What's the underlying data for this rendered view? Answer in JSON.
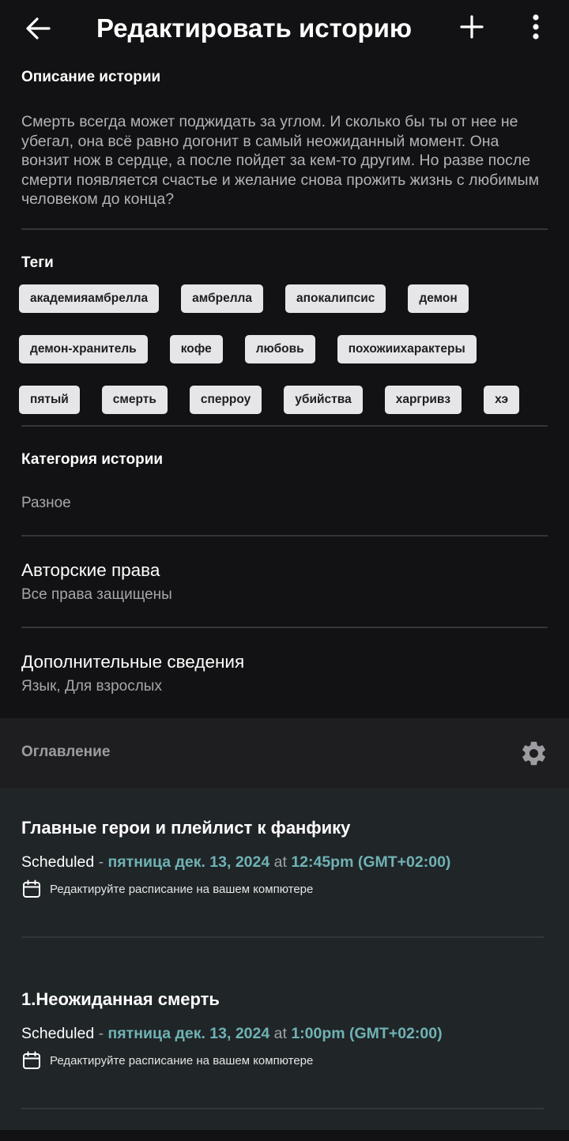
{
  "header": {
    "title": "Редактировать историю",
    "back_icon": "arrow-left-icon",
    "add_icon": "plus-icon",
    "menu_icon": "more-vertical-icon"
  },
  "description": {
    "label": "Описание истории",
    "text": "Смерть всегда может поджидать за углом. И сколько бы ты от нее не убегал, она всё равно догонит в самый неожиданный момент. Она вонзит нож в сердце, а после пойдет за кем-то другим. Но разве после смерти появляется счастье и желание снова прожить жизнь с любимым человеком до конца?"
  },
  "tags": {
    "label": "Теги",
    "items": [
      "академияамбрелла",
      "амбрелла",
      "апокалипсис",
      "демон",
      "демон-хранитель",
      "кофе",
      "любовь",
      "похожиихарактеры",
      "пятый",
      "смерть",
      "сперроу",
      "убийства",
      "харгривз",
      "хэ"
    ]
  },
  "category": {
    "label": "Категория истории",
    "value": "Разное"
  },
  "copyright": {
    "label": "Авторские права",
    "value": "Все права защищены"
  },
  "extra": {
    "label": "Дополнительные сведения",
    "value": "Язык, Для взрослых"
  },
  "toc": {
    "label": "Оглавление",
    "settings_icon": "gear-icon"
  },
  "parts": [
    {
      "title": "Главные герои и плейлист к фанфику",
      "status": "Scheduled",
      "dash": " - ",
      "date": "пятница дек. 13, 2024",
      "at": " at ",
      "time": "12:45pm (GMT+02:00)",
      "hint": "Редактируйте расписание на вашем компютере",
      "hint_icon": "calendar-icon"
    },
    {
      "title": "1.Неожиданная смерть",
      "status": "Scheduled",
      "dash": " - ",
      "date": "пятница дек. 13, 2024",
      "at": " at ",
      "time": "1:00pm (GMT+02:00)",
      "hint": "Редактируйте расписание на вашем компютере",
      "hint_icon": "calendar-icon"
    }
  ],
  "colors": {
    "background": "#121214",
    "accent_teal": "#6fb2b4",
    "tag_bg": "#e6e6e8",
    "parts_bg": "#202528"
  }
}
